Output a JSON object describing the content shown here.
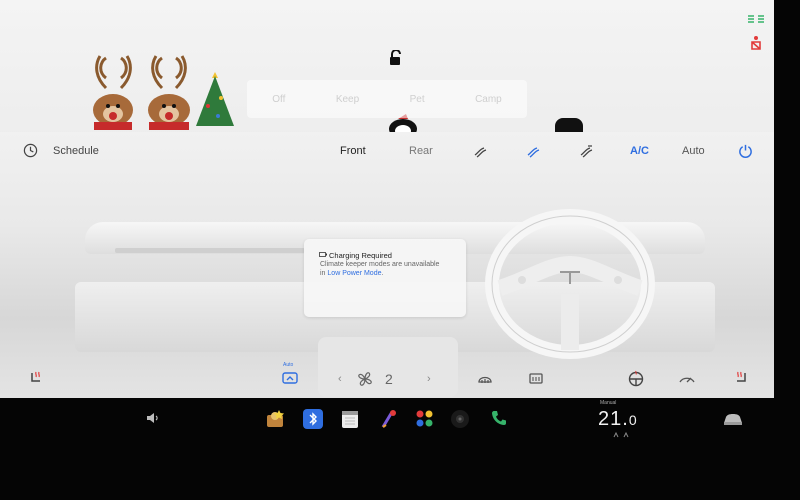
{
  "top": {
    "modes": [
      "Off",
      "Keep",
      "Pet",
      "Camp"
    ]
  },
  "climate": {
    "schedule_label": "Schedule",
    "zones": {
      "front": "Front",
      "rear": "Rear"
    },
    "ac_label": "A/C",
    "auto_label": "Auto",
    "accent_color": "#2f6ee0"
  },
  "alert": {
    "title": "Charging Required",
    "line1": "Climate keeper modes are unavailable",
    "line2_prefix": "in",
    "line2_link": "Low Power Mode",
    "line2_suffix": "."
  },
  "controls": {
    "auto_small": "Auto",
    "fan_speed": "2",
    "left_arrow": "‹",
    "right_arrow": "›"
  },
  "taskbar": {
    "temp_label": "Manual",
    "temp_main": "21.",
    "temp_decimal": "0"
  },
  "icons": [
    "lock-open-icon",
    "seatbelt-icon",
    "schedule-clock-icon",
    "airflow-face-icon",
    "airflow-feet-icon",
    "airflow-windshield-icon",
    "power-icon",
    "seat-heater-icon",
    "recirculation-icon",
    "fan-icon",
    "defrost-front-icon",
    "defrost-rear-icon",
    "steering-heater-icon",
    "volume-icon",
    "bluetooth-icon",
    "calendar-icon",
    "phone-icon",
    "car-icon"
  ]
}
